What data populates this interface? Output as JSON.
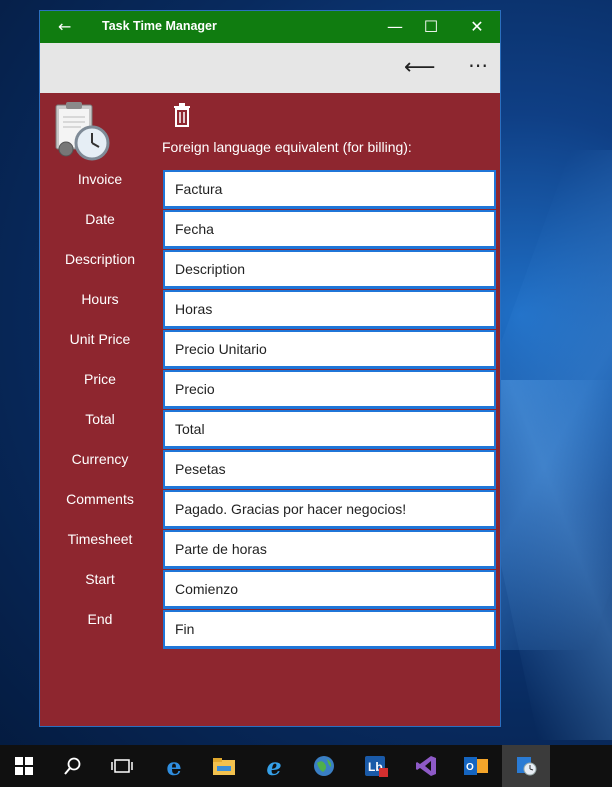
{
  "window": {
    "title": "Task Time Manager"
  },
  "header": {
    "label": "Foreign language equivalent (for billing):"
  },
  "rows": [
    {
      "label": "Invoice",
      "value": "Factura"
    },
    {
      "label": "Date",
      "value": "Fecha"
    },
    {
      "label": "Description",
      "value": "Description"
    },
    {
      "label": "Hours",
      "value": "Horas"
    },
    {
      "label": "Unit Price",
      "value": "Precio Unitario"
    },
    {
      "label": "Price",
      "value": "Precio"
    },
    {
      "label": "Total",
      "value": "Total"
    },
    {
      "label": "Currency",
      "value": "Pesetas"
    },
    {
      "label": "Comments",
      "value": "Pagado. Gracias por hacer negocios!"
    },
    {
      "label": "Timesheet",
      "value": "Parte de horas"
    },
    {
      "label": "Start",
      "value": "Comienzo"
    },
    {
      "label": "End",
      "value": "Fin"
    }
  ],
  "icons": {
    "titlebar": [
      "back-arrow-icon",
      "minimize-icon",
      "maximize-icon",
      "close-icon"
    ],
    "commandbar": [
      "back-arrow-icon",
      "more-icon"
    ],
    "taskbar": [
      "windows-start-icon",
      "search-icon",
      "task-view-icon",
      "edge-icon",
      "file-explorer-icon",
      "internet-explorer-icon",
      "globe-icon",
      "lb-app-icon",
      "visual-studio-icon",
      "outlook-icon",
      "task-time-manager-icon"
    ]
  },
  "colors": {
    "titlebar": "#107c10",
    "app_background": "#8e262f",
    "field_border": "#2076d8"
  }
}
